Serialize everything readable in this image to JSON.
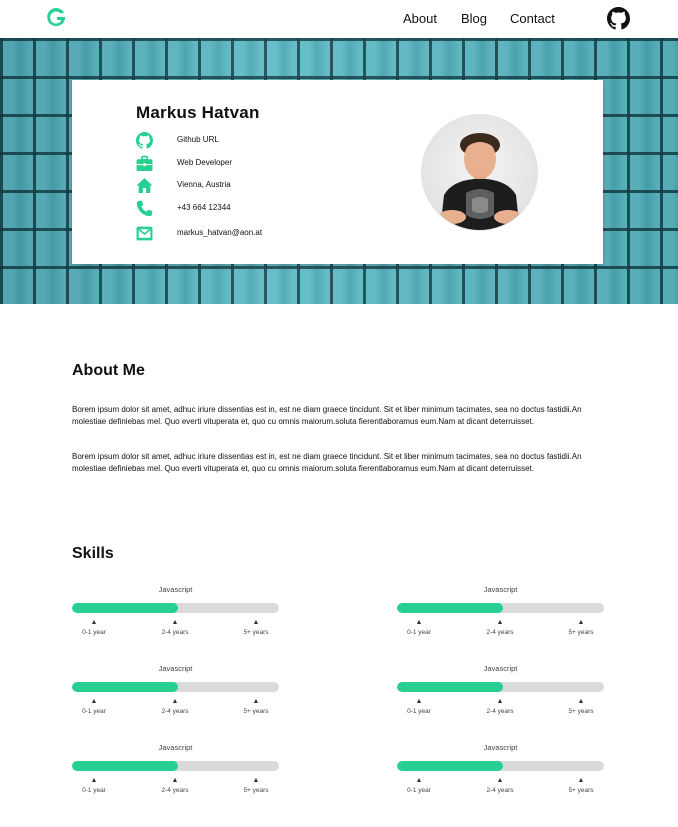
{
  "colors": {
    "accent": "#27cf90",
    "track": "#dadada",
    "hero_teal": "#4fb3bf"
  },
  "nav": {
    "logo_letter": "G",
    "links": [
      "About",
      "Blog",
      "Contact"
    ],
    "github_icon": "github-icon"
  },
  "profile": {
    "name": "Markus Hatvan",
    "rows": [
      {
        "icon": "github-icon",
        "text": "Github URL"
      },
      {
        "icon": "briefcase-icon",
        "text": "Web Developer"
      },
      {
        "icon": "home-icon",
        "text": "Vienna, Austria"
      },
      {
        "icon": "phone-icon",
        "text": "+43 664 12344"
      },
      {
        "icon": "mail-icon",
        "text": "markus_hatvan@aon.at"
      }
    ]
  },
  "about": {
    "title": "About Me",
    "paragraphs": [
      "Borem ipsum dolor sit amet, adhuc iriure dissentias est in, est ne diam graece tincidunt. Sit et liber minimum tacimates, sea no doctus fastidii.An molestiae definiebas mel. Quo everti vituperata et, quo cu omnis maiorum.soluta fierentlaboramus eum.Nam at dicant deterruisset.",
      "Borem ipsum dolor sit amet, adhuc iriure dissentias est in, est ne diam graece tincidunt. Sit et liber minimum tacimates, sea no doctus fastidii.An molestiae definiebas mel. Quo everti vituperata et, quo cu omnis maiorum.soluta fierentlaboramus eum.Nam at dicant deterruisset."
    ]
  },
  "skills": {
    "title": "Skills",
    "scale": [
      "0-1 year",
      "2-4 years",
      "5+ years"
    ],
    "items": [
      {
        "name": "Javascript",
        "level": 0.51
      },
      {
        "name": "Javascript",
        "level": 0.51
      },
      {
        "name": "Javascript",
        "level": 0.51
      },
      {
        "name": "Javascript",
        "level": 0.51
      },
      {
        "name": "Javascript",
        "level": 0.51
      },
      {
        "name": "Javascript",
        "level": 0.51
      }
    ]
  }
}
